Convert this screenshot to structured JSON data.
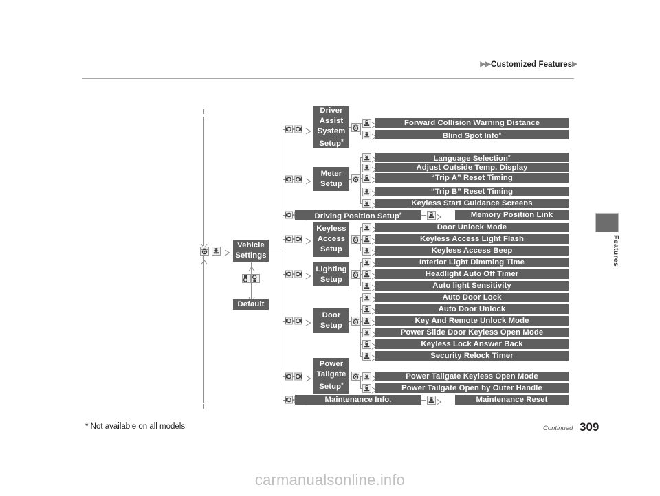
{
  "header": {
    "title": "Customized Features",
    "triangle_glyph": "▶"
  },
  "side_tab": {
    "label": "Features"
  },
  "footer": {
    "note": "* Not available on all models",
    "continued": "Continued",
    "page_number": "309",
    "watermark": "carmanualsonline.info"
  },
  "colors": {
    "bar_fill": "#5f5f5f",
    "bar_text": "#ffffff",
    "line": "#8f8f8f",
    "rule": "#a7a7a7",
    "tab_fill": "#6d6d6d"
  },
  "diagram": {
    "root": {
      "label_line1": "Vehicle",
      "label_line2": "Settings"
    },
    "default_node": {
      "label": "Default"
    },
    "groups": [
      {
        "id": "driver-assist-system-setup",
        "label_lines": [
          "Driver",
          "Assist",
          "System",
          "Setup"
        ],
        "asterisk": true,
        "items": [
          {
            "label": "Forward Collision Warning Distance",
            "asterisk": false
          },
          {
            "label": "Blind Spot Info",
            "asterisk": true
          }
        ]
      },
      {
        "id": "meter-setup",
        "label_lines": [
          "Meter",
          "Setup"
        ],
        "asterisk": false,
        "items": [
          {
            "label": "Language Selection",
            "asterisk": true
          },
          {
            "label": "Adjust Outside Temp. Display",
            "asterisk": false
          },
          {
            "label": "“Trip A” Reset Timing",
            "asterisk": false
          },
          {
            "label": "“Trip B” Reset Timing",
            "asterisk": false
          },
          {
            "label": "Keyless Start Guidance Screens",
            "asterisk": false
          }
        ]
      },
      {
        "id": "driving-position-setup",
        "label_lines": [
          "Driving Position Setup"
        ],
        "asterisk": true,
        "inline": true,
        "items": [
          {
            "label": "Memory Position Link",
            "asterisk": false
          }
        ]
      },
      {
        "id": "keyless-access-setup",
        "label_lines": [
          "Keyless",
          "Access",
          "Setup"
        ],
        "asterisk": false,
        "items": [
          {
            "label": "Door Unlock Mode",
            "asterisk": false
          },
          {
            "label": "Keyless Access Light Flash",
            "asterisk": false
          },
          {
            "label": "Keyless Access Beep",
            "asterisk": false
          }
        ]
      },
      {
        "id": "lighting-setup",
        "label_lines": [
          "Lighting",
          "Setup"
        ],
        "asterisk": false,
        "items": [
          {
            "label": "Interior Light Dimming Time",
            "asterisk": false
          },
          {
            "label": "Headlight Auto Off Timer",
            "asterisk": false
          },
          {
            "label": "Auto light Sensitivity",
            "asterisk": false
          }
        ]
      },
      {
        "id": "door-setup",
        "label_lines": [
          "Door",
          "Setup"
        ],
        "asterisk": false,
        "items": [
          {
            "label": "Auto Door Lock",
            "asterisk": false
          },
          {
            "label": "Auto Door Unlock",
            "asterisk": false
          },
          {
            "label": "Key And Remote Unlock Mode",
            "asterisk": false
          },
          {
            "label": "Power Slide Door Keyless Open Mode",
            "asterisk": false
          },
          {
            "label": "Keyless Lock Answer Back",
            "asterisk": false
          },
          {
            "label": "Security Relock Timer",
            "asterisk": false
          }
        ]
      },
      {
        "id": "power-tailgate-setup",
        "label_lines": [
          "Power",
          "Tailgate",
          "Setup"
        ],
        "asterisk": true,
        "items": [
          {
            "label": "Power Tailgate Keyless Open Mode",
            "asterisk": false
          },
          {
            "label": "Power Tailgate Open by Outer Handle",
            "asterisk": false
          }
        ]
      },
      {
        "id": "maintenance-info",
        "label_lines": [
          "Maintenance Info."
        ],
        "asterisk": false,
        "inline": true,
        "items": [
          {
            "label": "Maintenance Reset",
            "asterisk": false
          }
        ]
      }
    ],
    "icons": {
      "dial": "dial-knob-icon",
      "press": "press-button-icon",
      "arrow": "arrow-right-icon",
      "selector": "selector-knob-icon"
    }
  }
}
